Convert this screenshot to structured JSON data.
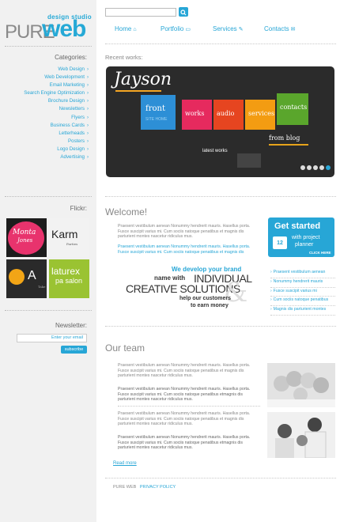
{
  "logo": {
    "pure": "PURE",
    "web": "web",
    "studio": "design studio"
  },
  "sidebar": {
    "categories_title": "Categories:",
    "categories": [
      "Web Design",
      "Web Development",
      "Email Marketing",
      "Search Engine Optimization",
      "Brochure Design",
      "Newsletters",
      "Flyers",
      "Business Cards",
      "Letterheads",
      "Posters",
      "Logo Design",
      "Advertising"
    ],
    "flickr_title": "Flickr:",
    "flickr_images": [
      {
        "text1": "Monta",
        "text2": "Jones"
      },
      {
        "text1": "Karm",
        "text2": "Parties"
      },
      {
        "text1": "A",
        "text2": "Take"
      },
      {
        "text1": "laturex",
        "text2": "pa salon"
      }
    ],
    "newsletter_title": "Newsletter:",
    "newsletter_placeholder": "Enter your email",
    "subscribe_label": "subscribe"
  },
  "header": {
    "nav": [
      {
        "label": "Home",
        "icon": "home-icon",
        "glyph": "⌂"
      },
      {
        "label": "Portfolio",
        "icon": "portfolio-icon",
        "glyph": "▭"
      },
      {
        "label": "Services",
        "icon": "wrench-icon",
        "glyph": "✎"
      },
      {
        "label": "Contacts",
        "icon": "envelope-icon",
        "glyph": "✉"
      }
    ]
  },
  "recent_works": {
    "title": "Recent works:",
    "slide": {
      "name": "Jayson",
      "tiles": [
        "front",
        "works",
        "audio",
        "services",
        "contacts"
      ],
      "front_sub": "SITE HOME",
      "blog": "from blog",
      "latest": "latest works"
    }
  },
  "welcome": {
    "title": "Welcome!",
    "para1": "Praesent vestibulum aenean Nonummy hendrerit mauris. Hasellus porta. Fusce suscipit varius mi. Cum sociis natoque penatibus et magnis dis parturient montes nascetur ridiculus mus.",
    "para1_link": "Praesent vestibulum aenean Nonummy hendrerit mauris. Hasellus porta. Fusce suscipit varius mi. Cum sociis natoque penatibus et magnis dis",
    "brand_line1": "We develop your brand",
    "brand_line2": "name with",
    "brand_line3": "INDIVIDUAL",
    "brand_line4": "CREATIVE SOLUTIONS",
    "brand_line5": "help our customers",
    "brand_line6": "to earn money",
    "get_started": {
      "title": "Get started",
      "sub1": "with project",
      "sub2": "planner",
      "day": "12",
      "cta": "CLICK HERE"
    },
    "links": [
      "Praesent vestibulum aenean",
      "Nonummy hendrerit mauris",
      "Fusce suscipit varius mi",
      "Cum sociis natoque penatibus",
      "Magnis dis parturient montes"
    ]
  },
  "team": {
    "title": "Our team",
    "para_a": "Praesent vestibulum aenean Nonummy hendrerit mauris. Hasellus porta. Fusce suscipit varius mi. Cum sociis natoque penatibus et magnis dis parturient montes nascetur ridiculus mus.",
    "para_b": "Praesent vestibulum aenean Nonummy hendrerit mauris. Hasellus porta. Fusce suscipit varius mi. Cum sociis natoque penatibus etmagnis dis parturient montes nascetur ridiculus mus.",
    "para_c": "Praesent vestibulum aenean Nonummy hendrerit mauris. Hasellus porta. Fusce suscipit varius mi. Cum sociis natoque penatibus et magnis dis parturient montes nascetur ridiculus mus.",
    "para_d": "Praesent vestibulum aenean Nonummy hendrerit mauris. Hasellus porta. Fusce suscipit varius mi. Cum sociis natoque penatibus etmagnis dis parturient montes nascetur ridiculus mus.",
    "read_more": "Read more"
  },
  "footer": {
    "brand": "PURE WEB",
    "privacy": "PRIVACY POLICY"
  },
  "colors": {
    "accent": "#27a6d6",
    "sidebar_bg": "#f1f1f1"
  }
}
